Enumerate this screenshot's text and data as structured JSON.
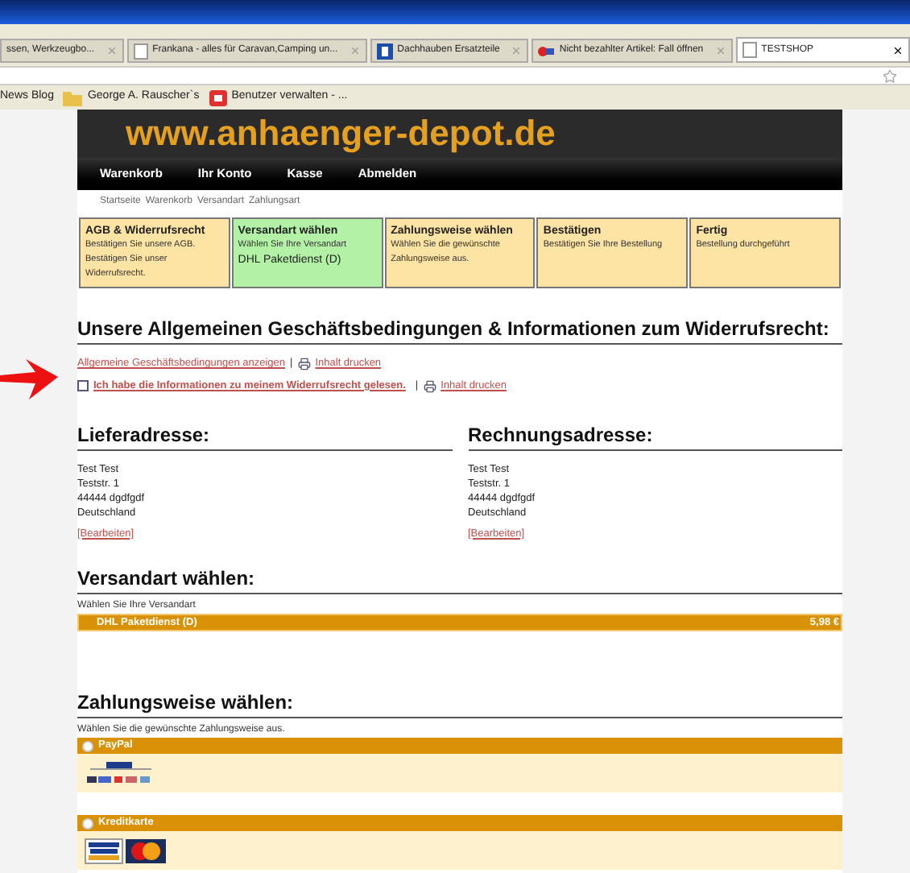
{
  "browser": {
    "tabs": [
      {
        "title": "ssen, Werkzeugbo...",
        "selected": false,
        "kind": "plain"
      },
      {
        "title": "Frankana - alles für Caravan,Camping un...",
        "selected": false,
        "kind": "page"
      },
      {
        "title": "Dachhauben Ersatzteile",
        "selected": false,
        "kind": "square"
      },
      {
        "title": "Nicht bezahlter Artikel: Fall öffnen",
        "selected": false,
        "kind": "flag"
      },
      {
        "title": "TESTSHOP",
        "selected": true,
        "kind": "page"
      }
    ],
    "bookmarks": [
      {
        "label": "News Blog",
        "kind": "plain"
      },
      {
        "label": "George A. Rauscher`s",
        "kind": "folder"
      },
      {
        "label": "Benutzer verwalten - ...",
        "kind": "logo"
      }
    ]
  },
  "header": {
    "logo": "www.anhaenger-depot.de"
  },
  "nav": [
    "Warenkorb",
    "Ihr Konto",
    "Kasse",
    "Abmelden"
  ],
  "breadcrumb": [
    "Startseite",
    "Warenkorb",
    "Versandart",
    "Zahlungsart"
  ],
  "steps": [
    {
      "title": "AGB & Widerrufsrecht",
      "text": "Bestätigen Sie unsere AGB. Bestätigen Sie unser Widerrufsrecht.",
      "selected": false
    },
    {
      "title": "Versandart wählen",
      "text": "Wählen Sie Ihre Versandart",
      "extra": "DHL Paketdienst (D)",
      "selected": true
    },
    {
      "title": "Zahlungsweise wählen",
      "text": "Wählen Sie die gewünschte Zahlungsweise aus.",
      "selected": false
    },
    {
      "title": "Bestätigen",
      "text": "Bestätigen Sie Ihre Bestellung",
      "selected": false
    },
    {
      "title": "Fertig",
      "text": "Bestellung durchgeführt",
      "selected": false
    }
  ],
  "agb": {
    "heading": "Unsere Allgemeinen Geschäftsbedingungen & Informationen zum Widerrufsrecht:",
    "link": "Allgemeine Geschäftsbedingungen anzeigen",
    "separator1": "|",
    "print1": "Inhalt drucken",
    "checkbox": {
      "label": "Ich habe die Informationen zu meinem Widerrufsrecht gelesen.",
      "checked": false
    },
    "separator2": "|",
    "print2": "Inhalt drucken"
  },
  "addresses": [
    {
      "heading": "Lieferadresse:",
      "lines": [
        "Test Test",
        "Teststr. 1",
        "44444 dgdfgdf",
        "Deutschland"
      ],
      "edit": "[Bearbeiten]"
    },
    {
      "heading": "Rechnungsadresse:",
      "lines": [
        "Test Test",
        "Teststr. 1",
        "44444 dgdfgdf",
        "Deutschland"
      ],
      "edit": "[Bearbeiten]"
    }
  ],
  "shipping": {
    "heading": "Versandart wählen:",
    "intro": "Wählen Sie Ihre Versandart",
    "options": [
      {
        "name": "DHL Paketdienst (D)",
        "price": "5,98 €"
      }
    ]
  },
  "payment": {
    "heading": "Zahlungsweise wählen:",
    "intro": "Wählen Sie die gewünschte Zahlungsweise aus.",
    "methods": [
      {
        "name": "PayPal",
        "kind": "paypal",
        "selected": false
      },
      {
        "name": "Kreditkarte",
        "kind": "card",
        "selected": false
      }
    ]
  }
}
